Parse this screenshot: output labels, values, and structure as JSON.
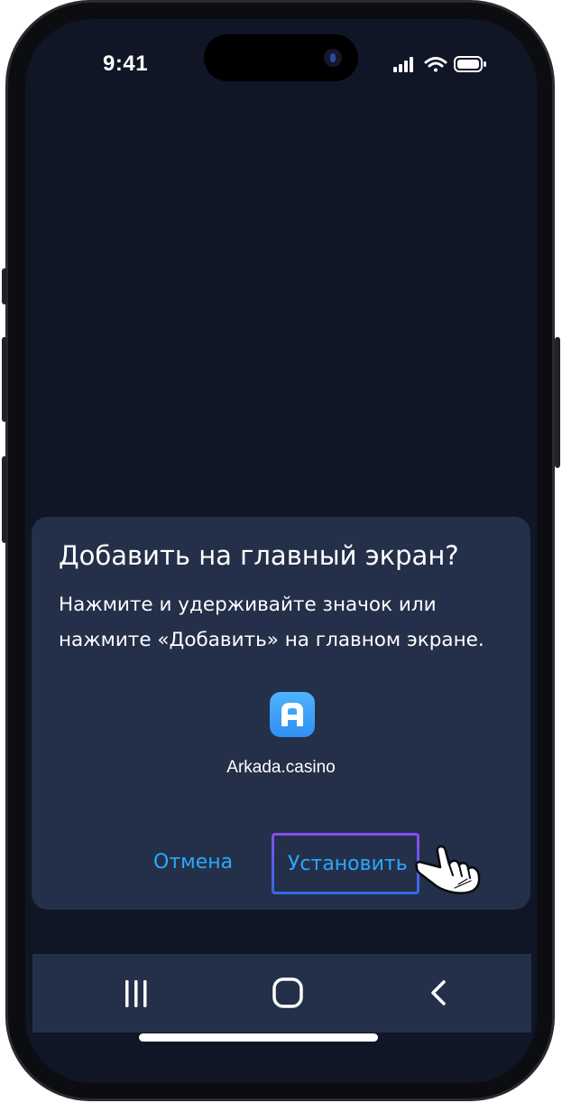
{
  "status_bar": {
    "time": "9:41",
    "icons": [
      "signal-icon",
      "wifi-icon",
      "battery-icon"
    ]
  },
  "dialog": {
    "title": "Добавить на главный экран?",
    "description": "Нажмите и удерживайте значок или нажмите «Добавить» на главном экране.",
    "app": {
      "icon": "arkada-app-icon",
      "icon_letter": "A",
      "name": "Arkada.casino"
    },
    "buttons": {
      "cancel_label": "Отмена",
      "install_label": "Установить"
    }
  },
  "navigation_bar": {
    "items": [
      "recent-apps-icon",
      "home-icon",
      "back-icon"
    ]
  },
  "colors": {
    "screen_bg": "#101626",
    "dialog_bg": "#243049",
    "accent": "#2aa8ff",
    "button_border_gradient": [
      "#8a4cf2",
      "#2f6de6"
    ]
  }
}
